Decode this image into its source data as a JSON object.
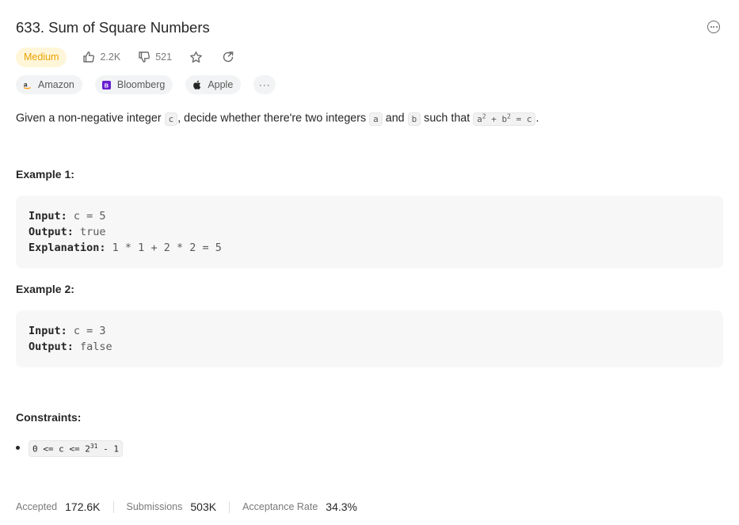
{
  "problem": {
    "title": "633. Sum of Square Numbers",
    "difficulty": "Medium",
    "likes": "2.2K",
    "dislikes": "521"
  },
  "tags": [
    {
      "label": "Amazon"
    },
    {
      "label": "Bloomberg"
    },
    {
      "label": "Apple"
    }
  ],
  "tags_more": "···",
  "description": {
    "p1": "Given a non-negative integer ",
    "c_var": "c",
    "p2": ", decide whether there're two integers ",
    "a_var": "a",
    "p3": " and ",
    "b_var": "b",
    "p4": " such that ",
    "eq_a": "a",
    "eq_sup1": "2",
    "eq_mid": " + b",
    "eq_sup2": "2",
    "eq_end": " = c",
    "p5": "."
  },
  "example1": {
    "heading": "Example 1:",
    "input_label": "Input:",
    "input_value": " c = 5",
    "output_label": "Output:",
    "output_value": " true",
    "explanation_label": "Explanation:",
    "explanation_value": " 1 * 1 + 2 * 2 = 5"
  },
  "example2": {
    "heading": "Example 2:",
    "input_label": "Input:",
    "input_value": " c = 3",
    "output_label": "Output:",
    "output_value": " false"
  },
  "constraints": {
    "heading": "Constraints:",
    "item_pre": "0 <= c <= 2",
    "item_sup": "31",
    "item_post": " - 1"
  },
  "footer": {
    "accepted_label": "Accepted",
    "accepted_value": "172.6K",
    "submissions_label": "Submissions",
    "submissions_value": "503K",
    "acceptance_label": "Acceptance Rate",
    "acceptance_value": "34.3%"
  },
  "colors": {
    "difficulty_text": "#e8a200",
    "difficulty_bg": "#fff6d9",
    "bloomberg": "#6a1fd1",
    "amazon": "#ff9900"
  },
  "icons": [
    "more-options-icon",
    "thumbs-up-icon",
    "thumbs-down-icon",
    "star-icon",
    "share-icon",
    "amazon-logo-icon",
    "bloomberg-logo-icon",
    "apple-logo-icon"
  ]
}
